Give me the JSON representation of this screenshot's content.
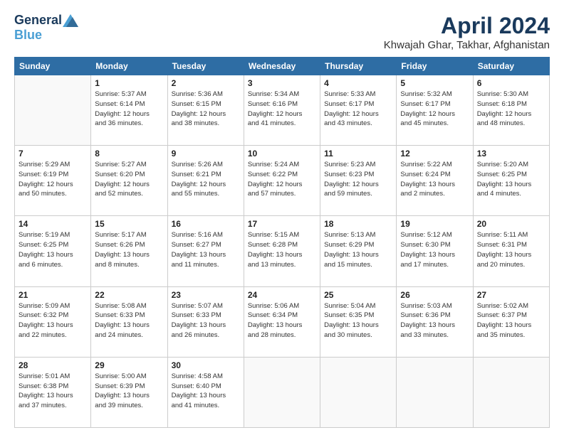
{
  "header": {
    "logo_general": "General",
    "logo_blue": "Blue",
    "title": "April 2024",
    "subtitle": "Khwajah Ghar, Takhar, Afghanistan"
  },
  "days_of_week": [
    "Sunday",
    "Monday",
    "Tuesday",
    "Wednesday",
    "Thursday",
    "Friday",
    "Saturday"
  ],
  "weeks": [
    [
      {
        "day": "",
        "sunrise": "",
        "sunset": "",
        "daylight": ""
      },
      {
        "day": "1",
        "sunrise": "Sunrise: 5:37 AM",
        "sunset": "Sunset: 6:14 PM",
        "daylight": "Daylight: 12 hours and 36 minutes."
      },
      {
        "day": "2",
        "sunrise": "Sunrise: 5:36 AM",
        "sunset": "Sunset: 6:15 PM",
        "daylight": "Daylight: 12 hours and 38 minutes."
      },
      {
        "day": "3",
        "sunrise": "Sunrise: 5:34 AM",
        "sunset": "Sunset: 6:16 PM",
        "daylight": "Daylight: 12 hours and 41 minutes."
      },
      {
        "day": "4",
        "sunrise": "Sunrise: 5:33 AM",
        "sunset": "Sunset: 6:17 PM",
        "daylight": "Daylight: 12 hours and 43 minutes."
      },
      {
        "day": "5",
        "sunrise": "Sunrise: 5:32 AM",
        "sunset": "Sunset: 6:17 PM",
        "daylight": "Daylight: 12 hours and 45 minutes."
      },
      {
        "day": "6",
        "sunrise": "Sunrise: 5:30 AM",
        "sunset": "Sunset: 6:18 PM",
        "daylight": "Daylight: 12 hours and 48 minutes."
      }
    ],
    [
      {
        "day": "7",
        "sunrise": "Sunrise: 5:29 AM",
        "sunset": "Sunset: 6:19 PM",
        "daylight": "Daylight: 12 hours and 50 minutes."
      },
      {
        "day": "8",
        "sunrise": "Sunrise: 5:27 AM",
        "sunset": "Sunset: 6:20 PM",
        "daylight": "Daylight: 12 hours and 52 minutes."
      },
      {
        "day": "9",
        "sunrise": "Sunrise: 5:26 AM",
        "sunset": "Sunset: 6:21 PM",
        "daylight": "Daylight: 12 hours and 55 minutes."
      },
      {
        "day": "10",
        "sunrise": "Sunrise: 5:24 AM",
        "sunset": "Sunset: 6:22 PM",
        "daylight": "Daylight: 12 hours and 57 minutes."
      },
      {
        "day": "11",
        "sunrise": "Sunrise: 5:23 AM",
        "sunset": "Sunset: 6:23 PM",
        "daylight": "Daylight: 12 hours and 59 minutes."
      },
      {
        "day": "12",
        "sunrise": "Sunrise: 5:22 AM",
        "sunset": "Sunset: 6:24 PM",
        "daylight": "Daylight: 13 hours and 2 minutes."
      },
      {
        "day": "13",
        "sunrise": "Sunrise: 5:20 AM",
        "sunset": "Sunset: 6:25 PM",
        "daylight": "Daylight: 13 hours and 4 minutes."
      }
    ],
    [
      {
        "day": "14",
        "sunrise": "Sunrise: 5:19 AM",
        "sunset": "Sunset: 6:25 PM",
        "daylight": "Daylight: 13 hours and 6 minutes."
      },
      {
        "day": "15",
        "sunrise": "Sunrise: 5:17 AM",
        "sunset": "Sunset: 6:26 PM",
        "daylight": "Daylight: 13 hours and 8 minutes."
      },
      {
        "day": "16",
        "sunrise": "Sunrise: 5:16 AM",
        "sunset": "Sunset: 6:27 PM",
        "daylight": "Daylight: 13 hours and 11 minutes."
      },
      {
        "day": "17",
        "sunrise": "Sunrise: 5:15 AM",
        "sunset": "Sunset: 6:28 PM",
        "daylight": "Daylight: 13 hours and 13 minutes."
      },
      {
        "day": "18",
        "sunrise": "Sunrise: 5:13 AM",
        "sunset": "Sunset: 6:29 PM",
        "daylight": "Daylight: 13 hours and 15 minutes."
      },
      {
        "day": "19",
        "sunrise": "Sunrise: 5:12 AM",
        "sunset": "Sunset: 6:30 PM",
        "daylight": "Daylight: 13 hours and 17 minutes."
      },
      {
        "day": "20",
        "sunrise": "Sunrise: 5:11 AM",
        "sunset": "Sunset: 6:31 PM",
        "daylight": "Daylight: 13 hours and 20 minutes."
      }
    ],
    [
      {
        "day": "21",
        "sunrise": "Sunrise: 5:09 AM",
        "sunset": "Sunset: 6:32 PM",
        "daylight": "Daylight: 13 hours and 22 minutes."
      },
      {
        "day": "22",
        "sunrise": "Sunrise: 5:08 AM",
        "sunset": "Sunset: 6:33 PM",
        "daylight": "Daylight: 13 hours and 24 minutes."
      },
      {
        "day": "23",
        "sunrise": "Sunrise: 5:07 AM",
        "sunset": "Sunset: 6:33 PM",
        "daylight": "Daylight: 13 hours and 26 minutes."
      },
      {
        "day": "24",
        "sunrise": "Sunrise: 5:06 AM",
        "sunset": "Sunset: 6:34 PM",
        "daylight": "Daylight: 13 hours and 28 minutes."
      },
      {
        "day": "25",
        "sunrise": "Sunrise: 5:04 AM",
        "sunset": "Sunset: 6:35 PM",
        "daylight": "Daylight: 13 hours and 30 minutes."
      },
      {
        "day": "26",
        "sunrise": "Sunrise: 5:03 AM",
        "sunset": "Sunset: 6:36 PM",
        "daylight": "Daylight: 13 hours and 33 minutes."
      },
      {
        "day": "27",
        "sunrise": "Sunrise: 5:02 AM",
        "sunset": "Sunset: 6:37 PM",
        "daylight": "Daylight: 13 hours and 35 minutes."
      }
    ],
    [
      {
        "day": "28",
        "sunrise": "Sunrise: 5:01 AM",
        "sunset": "Sunset: 6:38 PM",
        "daylight": "Daylight: 13 hours and 37 minutes."
      },
      {
        "day": "29",
        "sunrise": "Sunrise: 5:00 AM",
        "sunset": "Sunset: 6:39 PM",
        "daylight": "Daylight: 13 hours and 39 minutes."
      },
      {
        "day": "30",
        "sunrise": "Sunrise: 4:58 AM",
        "sunset": "Sunset: 6:40 PM",
        "daylight": "Daylight: 13 hours and 41 minutes."
      },
      {
        "day": "",
        "sunrise": "",
        "sunset": "",
        "daylight": ""
      },
      {
        "day": "",
        "sunrise": "",
        "sunset": "",
        "daylight": ""
      },
      {
        "day": "",
        "sunrise": "",
        "sunset": "",
        "daylight": ""
      },
      {
        "day": "",
        "sunrise": "",
        "sunset": "",
        "daylight": ""
      }
    ]
  ]
}
